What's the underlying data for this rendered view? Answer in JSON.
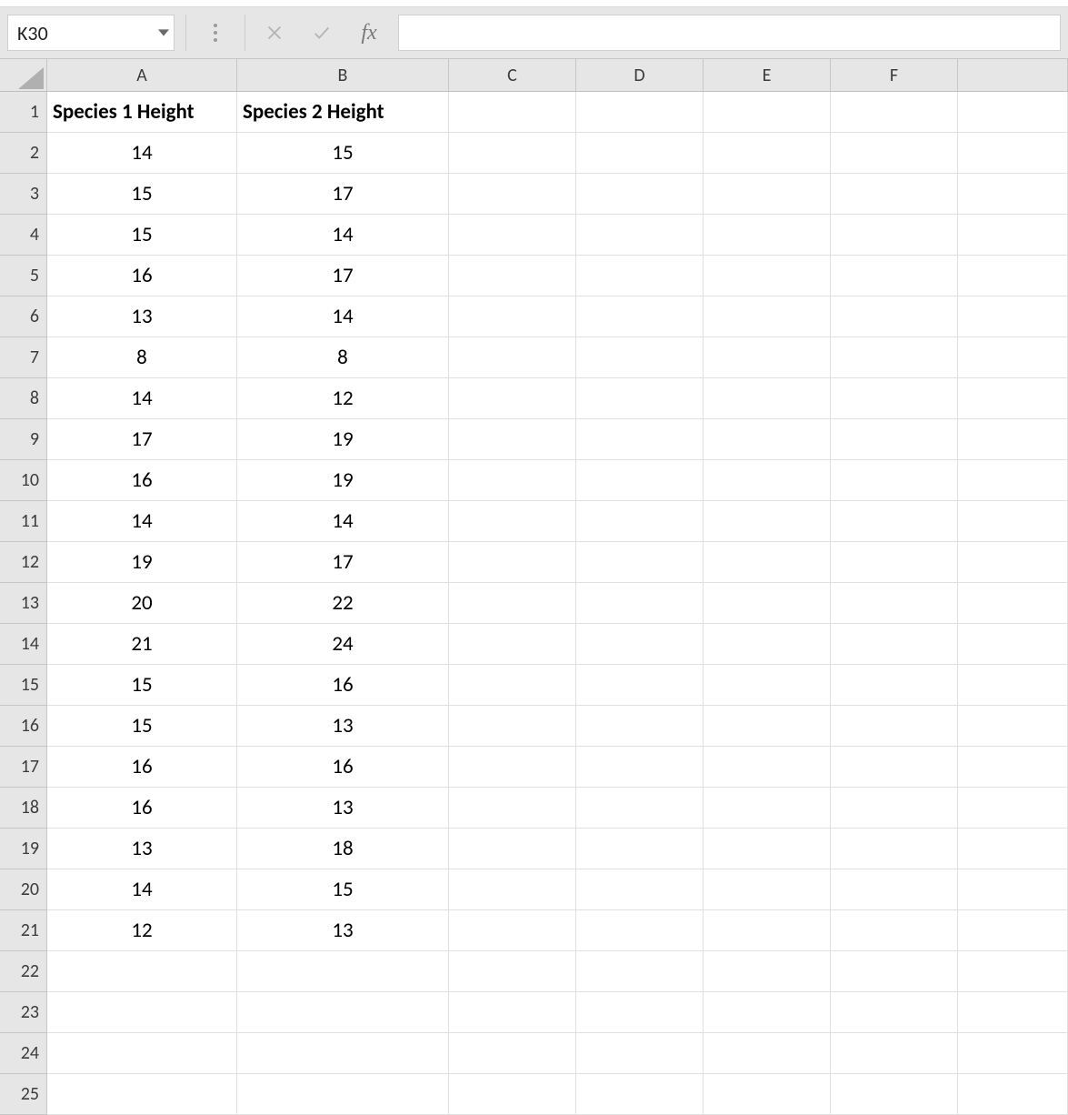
{
  "formula_bar": {
    "name_box": "K30",
    "formula_value": "",
    "fx_label": "fx"
  },
  "columns": [
    "A",
    "B",
    "C",
    "D",
    "E",
    "F"
  ],
  "row_numbers": [
    1,
    2,
    3,
    4,
    5,
    6,
    7,
    8,
    9,
    10,
    11,
    12,
    13,
    14,
    15,
    16,
    17,
    18,
    19,
    20,
    21,
    22,
    23,
    24,
    25
  ],
  "headers": {
    "A": "Species 1 Height",
    "B": "Species 2 Height"
  },
  "data": [
    {
      "A": "14",
      "B": "15"
    },
    {
      "A": "15",
      "B": "17"
    },
    {
      "A": "15",
      "B": "14"
    },
    {
      "A": "16",
      "B": "17"
    },
    {
      "A": "13",
      "B": "14"
    },
    {
      "A": "8",
      "B": "8"
    },
    {
      "A": "14",
      "B": "12"
    },
    {
      "A": "17",
      "B": "19"
    },
    {
      "A": "16",
      "B": "19"
    },
    {
      "A": "14",
      "B": "14"
    },
    {
      "A": "19",
      "B": "17"
    },
    {
      "A": "20",
      "B": "22"
    },
    {
      "A": "21",
      "B": "24"
    },
    {
      "A": "15",
      "B": "16"
    },
    {
      "A": "15",
      "B": "13"
    },
    {
      "A": "16",
      "B": "16"
    },
    {
      "A": "16",
      "B": "13"
    },
    {
      "A": "13",
      "B": "18"
    },
    {
      "A": "14",
      "B": "15"
    },
    {
      "A": "12",
      "B": "13"
    }
  ]
}
